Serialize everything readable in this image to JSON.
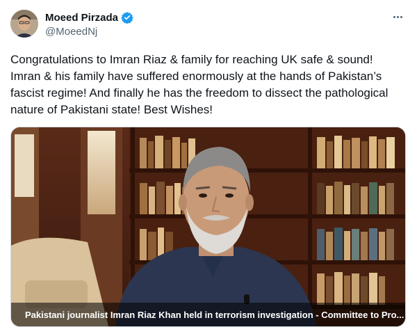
{
  "author": {
    "display_name": "Moeed Pirzada",
    "handle": "@MoeedNj",
    "verified_icon": "verified-badge-icon",
    "verified_color": "#1d9bf0"
  },
  "tweet": {
    "text": "Congratulations to Imran Riaz & family for reaching UK safe & sound!\nImran & his family have suffered enormously at the hands of Pakistan’s\nfascist regime! And finally he has the freedom to dissect the pathological\nnature of Pakistani state! Best Wishes!"
  },
  "media": {
    "caption": "Pakistani journalist Imran Riaz Khan held in terrorism investigation - Committee to Pro..."
  },
  "menu": {
    "icon": "more-options-icon"
  }
}
